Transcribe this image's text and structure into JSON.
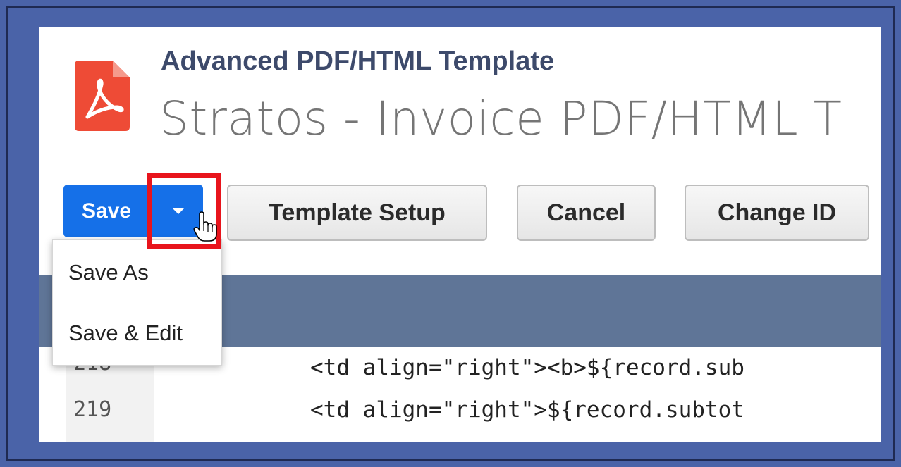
{
  "header": {
    "record_type": "Advanced PDF/HTML Template",
    "record_title": "Stratos - Invoice PDF/HTML T"
  },
  "toolbar": {
    "save_label": "Save",
    "template_setup_label": "Template Setup",
    "cancel_label": "Cancel",
    "change_id_label": "Change ID"
  },
  "save_menu": {
    "items": [
      {
        "label": "Save As"
      },
      {
        "label": "Save & Edit"
      }
    ]
  },
  "code_editor": {
    "lines": [
      {
        "number": "218",
        "text": "<td align=\"right\"><b>${record.sub"
      },
      {
        "number": "219",
        "text": "<td align=\"right\">${record.subtot"
      }
    ]
  },
  "colors": {
    "background": "#4a63a8",
    "primary_button": "#1570e8",
    "highlight": "#e8141c",
    "header_bar": "#5f7597",
    "pdf_icon": "#ee4b36"
  },
  "icons": {
    "record_icon": "pdf-file-icon",
    "caret": "caret-down-icon",
    "cursor": "hand-pointer-icon"
  }
}
